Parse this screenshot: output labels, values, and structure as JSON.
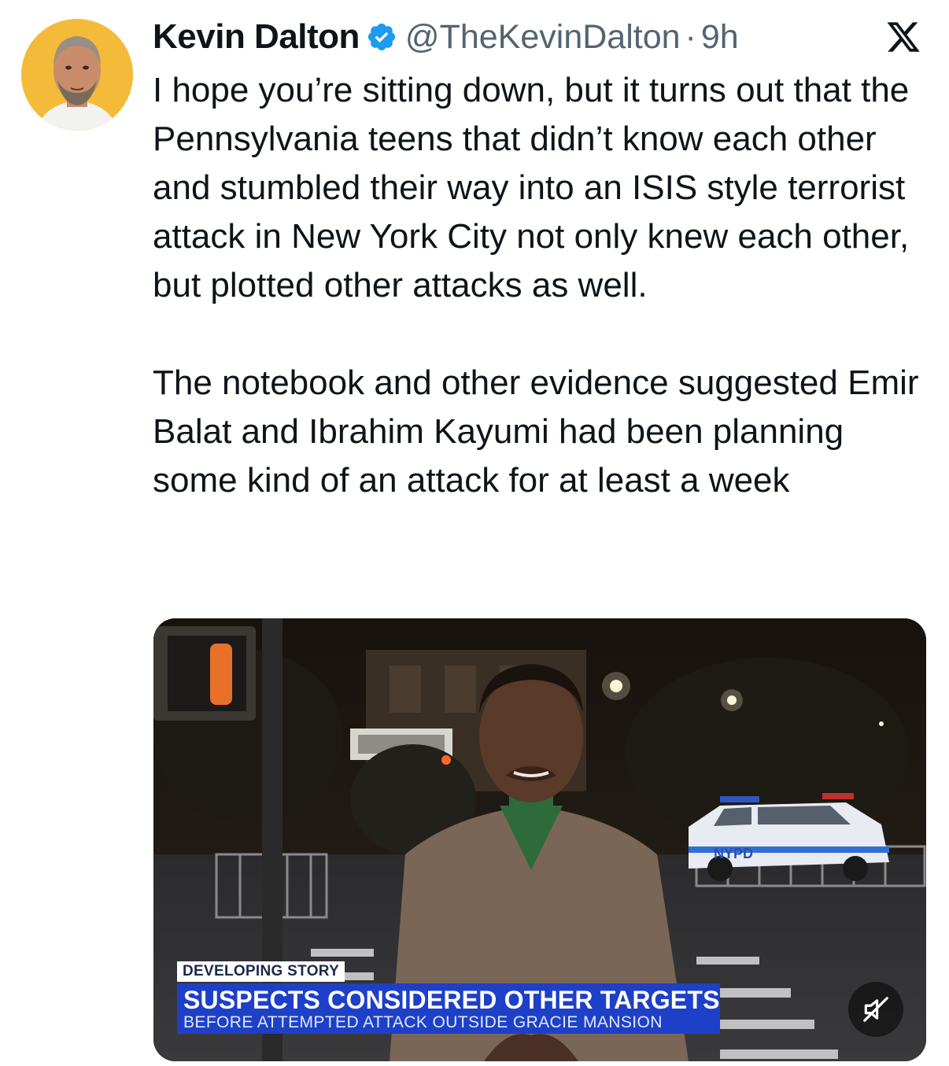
{
  "post": {
    "author_name": "Kevin Dalton",
    "handle": "@TheKevinDalton",
    "separator": "·",
    "time": "9h",
    "paragraphs": [
      "I hope you’re sitting down, but it turns out that the Pennsylvania teens that didn’t know each other and stumbled their way into an ISIS style terrorist attack in New York City not only knew each other, but plotted other attacks as well.",
      "The notebook and other evidence suggested Emir Balat and Ibrahim Kayumi had been planning some kind of an attack for at least a week"
    ]
  },
  "icons": {
    "verified": "verified-badge-icon",
    "platform": "x-logo-icon",
    "mute": "speaker-muted-icon"
  },
  "media": {
    "tag": "DEVELOPING STORY",
    "headline": "SUSPECTS CONSIDERED OTHER TARGETS",
    "subline": "BEFORE ATTEMPTED ATTACK OUTSIDE GRACIE MANSION",
    "vehicle_text": "NYPD"
  },
  "colors": {
    "verified_blue": "#1d9bf0",
    "avatar_bg": "#f4bb3a",
    "news_blue": "#1e40c8"
  }
}
